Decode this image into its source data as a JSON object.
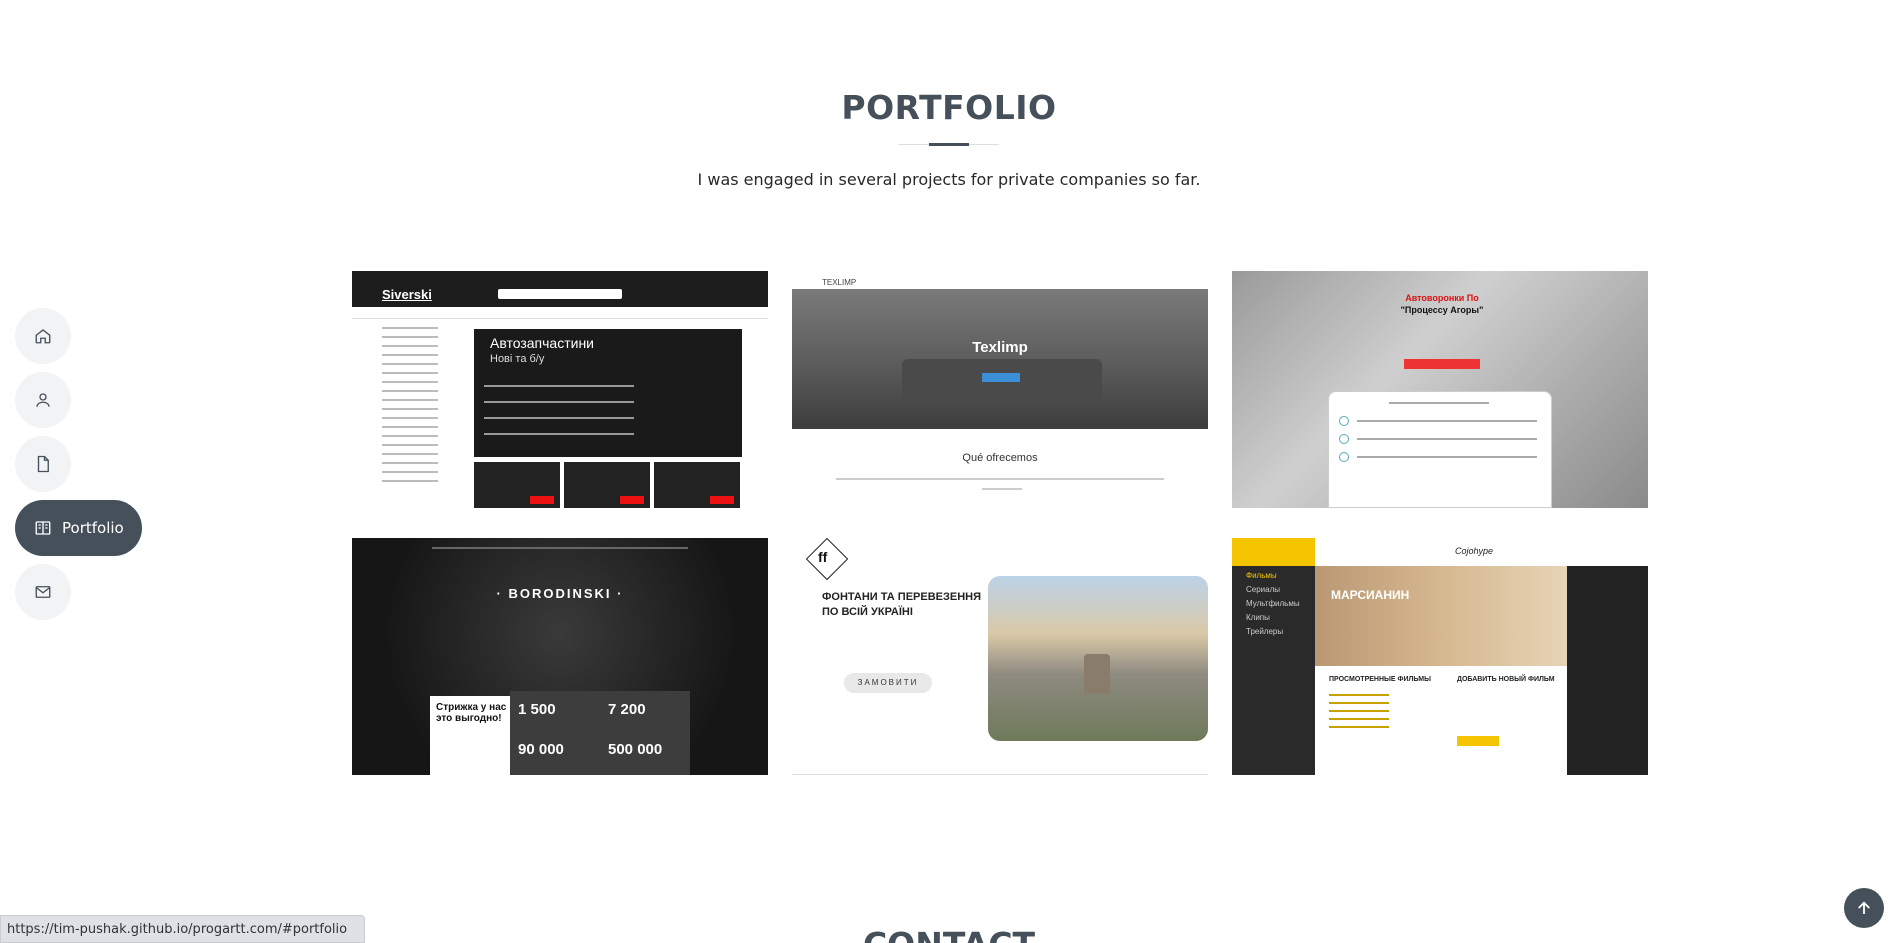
{
  "section": {
    "title": "PORTFOLIO",
    "subtitle": "I was engaged in several projects for private companies so far."
  },
  "nav": {
    "items": [
      {
        "icon": "home-icon",
        "label": "Home"
      },
      {
        "icon": "user-icon",
        "label": "About"
      },
      {
        "icon": "file-icon",
        "label": "Resume"
      },
      {
        "icon": "book-icon",
        "label": "Portfolio",
        "active": true
      },
      {
        "icon": "envelope-icon",
        "label": "Contact"
      }
    ],
    "active_label": "Portfolio"
  },
  "portfolio": {
    "items": [
      {
        "id": "siverski",
        "logo": "Siverski",
        "banner_title": "Автозапчастини",
        "banner_sub": "Нові та б/у"
      },
      {
        "id": "texlimp",
        "brand": "TEXLIMP",
        "hero_title": "Texlimp",
        "section_title": "Qué ofrecemos"
      },
      {
        "id": "avtovoronki",
        "header_red": "Автоворонки По",
        "header_black": "\"Процессу Агоры\""
      },
      {
        "id": "borodinski",
        "logo": "· BORODINSKI ·",
        "promo": "Стрижка у нас это выгодно!",
        "stats": [
          "1 500",
          "7 200",
          "90 000",
          "500 000"
        ]
      },
      {
        "id": "fontany",
        "logo": "ff",
        "headline": "ФОНТАНИ ТА ПЕРЕВЕЗЕННЯ ПО ВСІЙ УКРАЇНІ",
        "button": "ЗАМОВИТИ"
      },
      {
        "id": "marsianin",
        "brand": "Cojohype",
        "hero_title": "МАРСИАНИН",
        "menu": [
          "Фильмы",
          "Сериалы",
          "Мультфильмы",
          "Клипы",
          "Трейлеры"
        ],
        "col1": "ПРОСМОТРЕННЫЕ ФИЛЬМЫ",
        "col2": "ДОБАВИТЬ НОВЫЙ ФИЛЬМ"
      }
    ]
  },
  "statusbar": {
    "url": "https://tim-pushak.github.io/progartt.com/#portfolio"
  },
  "next_section": {
    "title": "CONTACT"
  },
  "back_to_top": {
    "icon": "arrow-up-icon"
  },
  "colors": {
    "accent": "#45505b",
    "nav_bg": "#f2f3f5"
  }
}
